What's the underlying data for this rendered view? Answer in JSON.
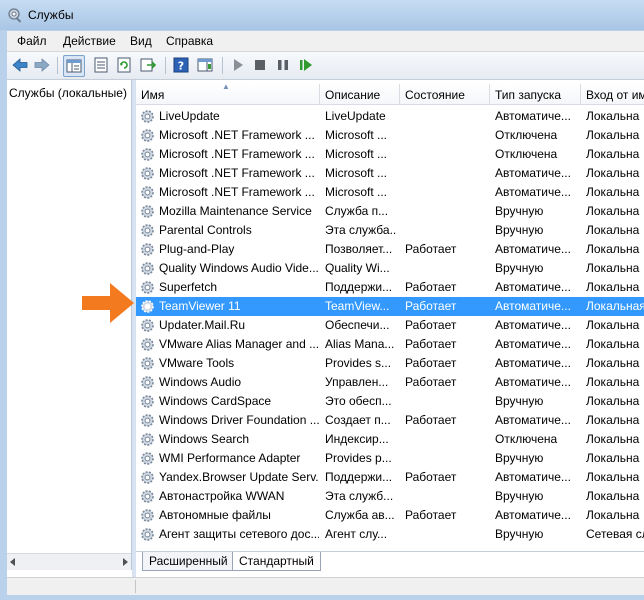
{
  "window": {
    "title": "Службы"
  },
  "menu": [
    "Файл",
    "Действие",
    "Вид",
    "Справка"
  ],
  "toolbar": {
    "icons": [
      "back-arrow-icon",
      "forward-arrow-icon",
      "show-hide-console-tree-icon",
      "properties-icon",
      "refresh-icon",
      "export-list-icon",
      "help-icon",
      "show-hide-action-pane-icon",
      "start-service-icon",
      "stop-service-icon",
      "pause-service-icon",
      "restart-service-icon"
    ]
  },
  "tree": {
    "root_label": "Службы (локальные)"
  },
  "columns": {
    "name": "Имя",
    "description": "Описание",
    "status": "Состояние",
    "startup": "Тип запуска",
    "logon": "Вход от им"
  },
  "services": [
    {
      "name": "LiveUpdate",
      "description": "LiveUpdate",
      "status": "",
      "startup": "Автоматиче...",
      "logon": "Локальна"
    },
    {
      "name": "Microsoft .NET Framework ...",
      "description": "Microsoft ...",
      "status": "",
      "startup": "Отключена",
      "logon": "Локальна"
    },
    {
      "name": "Microsoft .NET Framework ...",
      "description": "Microsoft ...",
      "status": "",
      "startup": "Отключена",
      "logon": "Локальна"
    },
    {
      "name": "Microsoft .NET Framework ...",
      "description": "Microsoft ...",
      "status": "",
      "startup": "Автоматиче...",
      "logon": "Локальна"
    },
    {
      "name": "Microsoft .NET Framework ...",
      "description": "Microsoft ...",
      "status": "",
      "startup": "Автоматиче...",
      "logon": "Локальна"
    },
    {
      "name": "Mozilla Maintenance Service",
      "description": "Служба п...",
      "status": "",
      "startup": "Вручную",
      "logon": "Локальна"
    },
    {
      "name": "Parental Controls",
      "description": "Эта служба...",
      "status": "",
      "startup": "Вручную",
      "logon": "Локальна"
    },
    {
      "name": "Plug-and-Play",
      "description": "Позволяет...",
      "status": "Работает",
      "startup": "Автоматиче...",
      "logon": "Локальна"
    },
    {
      "name": "Quality Windows Audio Vide...",
      "description": "Quality Wi...",
      "status": "",
      "startup": "Вручную",
      "logon": "Локальна"
    },
    {
      "name": "Superfetch",
      "description": "Поддержи...",
      "status": "Работает",
      "startup": "Автоматиче...",
      "logon": "Локальна"
    },
    {
      "name": "TeamViewer 11",
      "description": "TeamView...",
      "status": "Работает",
      "startup": "Автоматиче...",
      "logon": "Локальная"
    },
    {
      "name": "Updater.Mail.Ru",
      "description": "Обеспечи...",
      "status": "Работает",
      "startup": "Автоматиче...",
      "logon": "Локальна"
    },
    {
      "name": "VMware Alias Manager and ...",
      "description": "Alias Mana...",
      "status": "Работает",
      "startup": "Автоматиче...",
      "logon": "Локальна"
    },
    {
      "name": "VMware Tools",
      "description": "Provides s...",
      "status": "Работает",
      "startup": "Автоматиче...",
      "logon": "Локальна"
    },
    {
      "name": "Windows Audio",
      "description": "Управлен...",
      "status": "Работает",
      "startup": "Автоматиче...",
      "logon": "Локальна"
    },
    {
      "name": "Windows CardSpace",
      "description": "Это обесп...",
      "status": "",
      "startup": "Вручную",
      "logon": "Локальна"
    },
    {
      "name": "Windows Driver Foundation ...",
      "description": "Создает п...",
      "status": "Работает",
      "startup": "Автоматиче...",
      "logon": "Локальна"
    },
    {
      "name": "Windows Search",
      "description": "Индексир...",
      "status": "",
      "startup": "Отключена",
      "logon": "Локальна"
    },
    {
      "name": "WMI Performance Adapter",
      "description": "Provides p...",
      "status": "",
      "startup": "Вручную",
      "logon": "Локальна"
    },
    {
      "name": "Yandex.Browser Update Serv...",
      "description": "Поддержи...",
      "status": "Работает",
      "startup": "Автоматиче...",
      "logon": "Локальна"
    },
    {
      "name": "Автонастройка WWAN",
      "description": "Эта служб...",
      "status": "",
      "startup": "Вручную",
      "logon": "Локальна"
    },
    {
      "name": "Автономные файлы",
      "description": "Служба ав...",
      "status": "Работает",
      "startup": "Автоматиче...",
      "logon": "Локальна"
    },
    {
      "name": "Агент защиты сетевого дос...",
      "description": "Агент слу...",
      "status": "",
      "startup": "Вручную",
      "logon": "Сетевая сл"
    }
  ],
  "selected_service": "TeamViewer 11",
  "tabs": [
    "Расширенный",
    "Стандартный"
  ],
  "colors": {
    "selection": "#3399ff",
    "pointer_arrow": "#f47a20"
  }
}
